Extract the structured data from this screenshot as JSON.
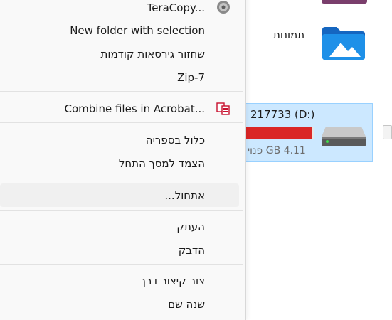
{
  "explorer": {
    "folder_label": "תמונות",
    "drive": {
      "label": "217733 (D:)",
      "free_text": "4.11 GB פנוי",
      "usage_fraction": 0.96
    }
  },
  "menu": {
    "items": [
      {
        "label": "TeraCopy...",
        "icon": "teracopy-icon"
      },
      {
        "label": "New folder with selection"
      },
      {
        "label": "שחזור גירסאות קודמות"
      },
      {
        "label": "7-Zip"
      },
      {
        "label": "Combine files in Acrobat...",
        "icon": "acrobat-combine-icon"
      },
      {
        "label": "כלול בספריה"
      },
      {
        "label": "הצמד למסך התחל"
      },
      {
        "label": "אתחול..."
      },
      {
        "label": "העתק"
      },
      {
        "label": "הדבק"
      },
      {
        "label": "צור קיצור דרך"
      },
      {
        "label": "שנה שם"
      }
    ]
  },
  "colors": {
    "accent_selection": "#cce8ff",
    "drive_bar_full": "#da2626",
    "folder_blue": "#1e90e8"
  }
}
